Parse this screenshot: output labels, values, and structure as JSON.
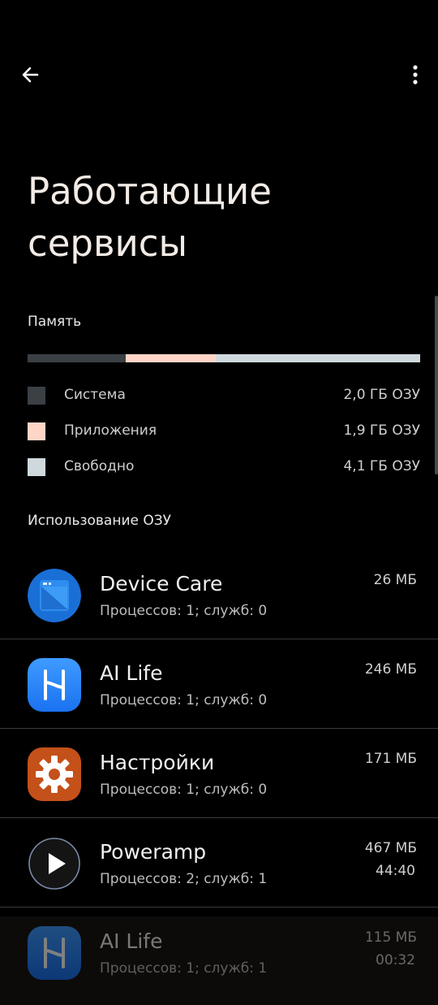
{
  "page": {
    "title_line1": "Работающие",
    "title_line2": "сервисы"
  },
  "memory": {
    "label": "Память",
    "bar": [
      {
        "key": "system",
        "fraction": 0.25,
        "color": "#3a4044"
      },
      {
        "key": "apps",
        "fraction": 0.23,
        "color": "#ffd5c7"
      },
      {
        "key": "free",
        "fraction": 0.52,
        "color": "#cfd9dd"
      }
    ],
    "legend": [
      {
        "label": "Система",
        "value": "2,0 ГБ ОЗУ",
        "color": "#3a4044"
      },
      {
        "label": "Приложения",
        "value": "1,9 ГБ ОЗУ",
        "color": "#ffd5c7"
      },
      {
        "label": "Свободно",
        "value": "4,1 ГБ ОЗУ",
        "color": "#cfd9dd"
      }
    ]
  },
  "ram_usage": {
    "label": "Использование ОЗУ"
  },
  "apps": [
    {
      "name": "Device Care",
      "processes": "Процессов: 1; служб: 0",
      "memory": "26 МБ",
      "time": "",
      "icon": "device-care-icon"
    },
    {
      "name": "AI Life",
      "processes": "Процессов: 1; служб: 0",
      "memory": "246 МБ",
      "time": "",
      "icon": "ai-life-icon"
    },
    {
      "name": "Настройки",
      "processes": "Процессов: 1; служб: 0",
      "memory": "171 МБ",
      "time": "",
      "icon": "settings-gear-icon"
    },
    {
      "name": "Poweramp",
      "processes": "Процессов: 2; служб: 1",
      "memory": "467 МБ",
      "time": "44:40",
      "icon": "play-icon"
    },
    {
      "name": "AI Life",
      "processes": "Процессов: 1; служб: 1",
      "memory": "115 МБ",
      "time": "00:32",
      "icon": "ai-life-icon"
    }
  ]
}
